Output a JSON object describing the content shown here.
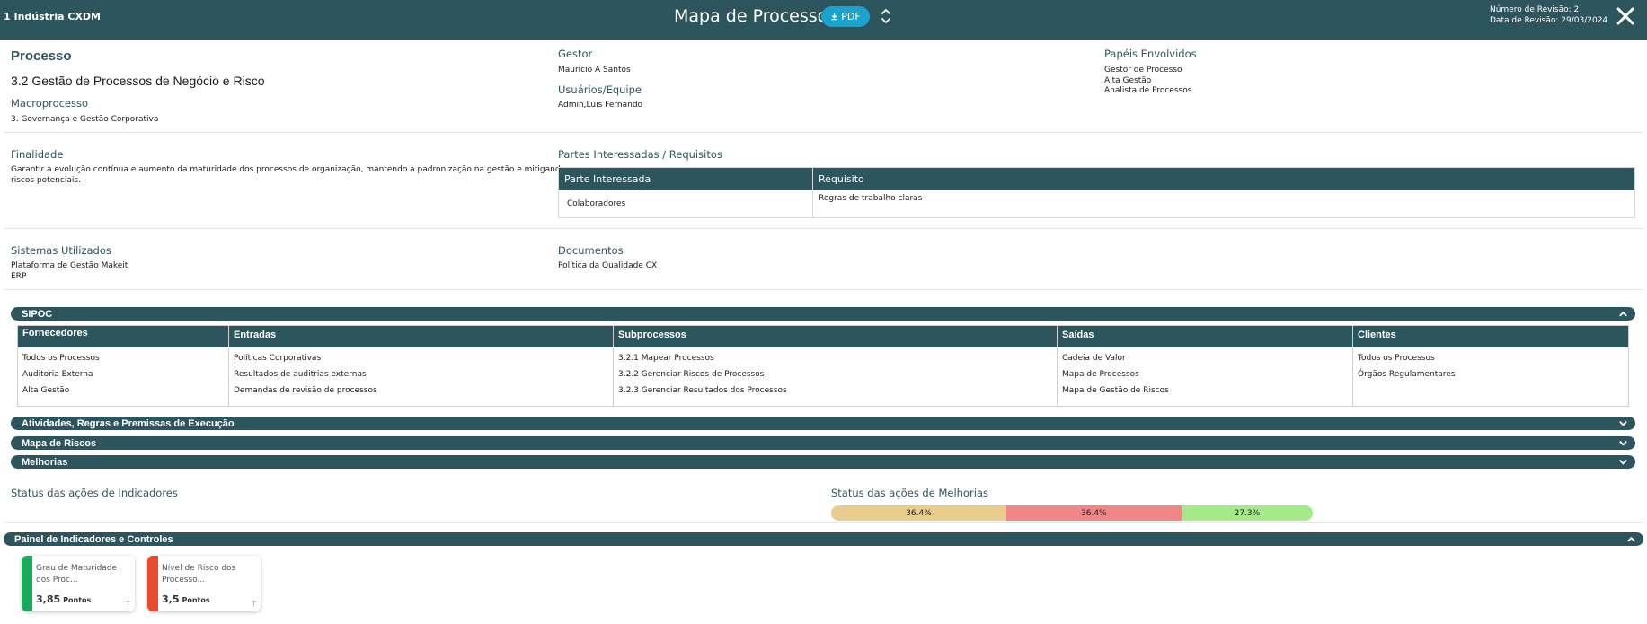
{
  "header": {
    "company": "1 Indústria CXDM",
    "title": "Mapa de Processo",
    "pdf_label": "PDF",
    "revision_number": "Número de Revisão: 2",
    "revision_date": "Data de Revisão: 29/03/2024"
  },
  "process": {
    "section_label": "Processo",
    "name": "3.2 Gestão de Processos de Negócio e Risco",
    "macro_label": "Macroprocesso",
    "macro_value": "3. Governança e Gestão Corporativa",
    "manager_label": "Gestor",
    "manager_value": "Mauricio A Santos",
    "users_label": "Usuários/Equipe",
    "users_value": "Admin,Luis Fernando",
    "roles_label": "Papéis Envolvidos",
    "roles": [
      "Gestor de Processo",
      "Alta Gestão",
      "Analista de Processos"
    ]
  },
  "purpose": {
    "label": "Finalidade",
    "text_line1": "Garantir a evolução contínua e aumento da maturidade dos processos de organização, mantendo a padronização na gestão e mitigando os",
    "text_line2": "riscos potenciais."
  },
  "stakeholders": {
    "label": "Partes Interessadas / Requisitos",
    "col_party": "Parte Interessada",
    "col_requirement": "Requisito",
    "rows": [
      {
        "party": "Colaboradores",
        "requirement": "Regras de trabalho claras"
      }
    ]
  },
  "systems": {
    "label": "Sistemas Utilizados",
    "items": [
      "Plataforma de Gestão Makeit",
      "ERP"
    ]
  },
  "documents": {
    "label": "Documentos",
    "items": [
      "Política da Qualidade CX"
    ]
  },
  "sipoc": {
    "title": "SIPOC",
    "columns": [
      {
        "header": "Fornecedores",
        "items": [
          "Todos os Processos",
          "Auditoria Externa",
          "Alta Gestão"
        ]
      },
      {
        "header": "Entradas",
        "items": [
          "Políticas Corporativas",
          "Resultados de auditrias externas",
          "Demandas de revisão de processos"
        ]
      },
      {
        "header": "Subprocessos",
        "items": [
          "3.2.1 Mapear Processos",
          "3.2.2 Gerenciar Riscos de Processos",
          "3.2.3 Gerenciar Resultados dos Processos"
        ]
      },
      {
        "header": "Saídas",
        "items": [
          "Cadeia de Valor",
          "Mapa de Processos",
          "Mapa de Gestão de Riscos"
        ]
      },
      {
        "header": "Clientes",
        "items": [
          "Todos os Processos",
          "Órgãos Regulamentares"
        ]
      }
    ]
  },
  "sections": {
    "activities": "Atividades, Regras e Premissas de Execução",
    "risk_map": "Mapa de Riscos",
    "improvements": "Melhorias",
    "panel": "Painel de Indicadores e Controles"
  },
  "status": {
    "indicators_label": "Status das ações de Indicadores",
    "improvements_label": "Status das ações de Melhorias",
    "segments": [
      {
        "label": "36.4%",
        "value": 36.4,
        "color": "#e8cd8e"
      },
      {
        "label": "36.4%",
        "value": 36.4,
        "color": "#f08686"
      },
      {
        "label": "27.3%",
        "value": 27.3,
        "color": "#a4e98a"
      }
    ]
  },
  "indicators": [
    {
      "name_line1": "Grau de Maturidade",
      "name_line2": "dos Proc...",
      "value": "3,85",
      "unit": "Pontos",
      "mark": "T",
      "color": "#1aa85a"
    },
    {
      "name_line1": "Nível de Risco dos",
      "name_line2": "Processo...",
      "value": "3,5",
      "unit": "Pontos",
      "mark": "T",
      "color": "#ea4b2f"
    }
  ]
}
